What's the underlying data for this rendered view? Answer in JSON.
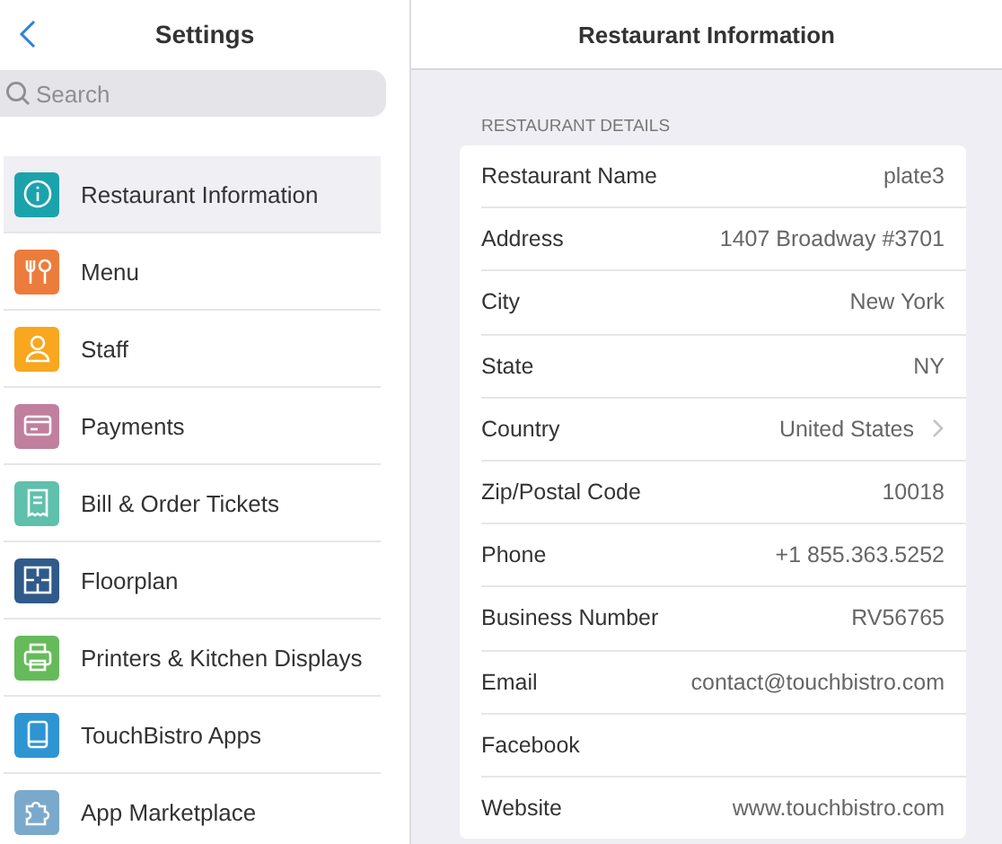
{
  "sidebar": {
    "title": "Settings",
    "search": {
      "placeholder": "Search"
    },
    "items": [
      {
        "label": "Restaurant Information",
        "kind": "info",
        "color": "#1ba3ac",
        "selected": true
      },
      {
        "label": "Menu",
        "kind": "utensils",
        "color": "#ec7c3c",
        "selected": false
      },
      {
        "label": "Staff",
        "kind": "person",
        "color": "#f8a71e",
        "selected": false
      },
      {
        "label": "Payments",
        "kind": "card",
        "color": "#c17f9e",
        "selected": false
      },
      {
        "label": "Bill & Order Tickets",
        "kind": "receipt",
        "color": "#5fc0ab",
        "selected": false
      },
      {
        "label": "Floorplan",
        "kind": "floorplan",
        "color": "#2f5a8a",
        "selected": false
      },
      {
        "label": "Printers & Kitchen Displays",
        "kind": "printer",
        "color": "#65bb5a",
        "selected": false
      },
      {
        "label": "TouchBistro Apps",
        "kind": "tablet",
        "color": "#2e95d3",
        "selected": false
      },
      {
        "label": "App Marketplace",
        "kind": "puzzle",
        "color": "#7aa9cc",
        "selected": false
      }
    ]
  },
  "detail": {
    "title": "Restaurant Information",
    "section": "RESTAURANT DETAILS",
    "rows": [
      {
        "label": "Restaurant Name",
        "value": "plate3",
        "kind": "text"
      },
      {
        "label": "Address",
        "value": "1407 Broadway #3701",
        "kind": "text"
      },
      {
        "label": "City",
        "value": "New York",
        "kind": "text"
      },
      {
        "label": "State",
        "value": "NY",
        "kind": "text"
      },
      {
        "label": "Country",
        "value": "United States",
        "kind": "link"
      },
      {
        "label": "Zip/Postal Code",
        "value": "10018",
        "kind": "text"
      },
      {
        "label": "Phone",
        "value": "+1 855.363.5252",
        "kind": "text"
      },
      {
        "label": "Business Number",
        "value": "RV56765",
        "kind": "text"
      },
      {
        "label": "Email",
        "value": "contact@touchbistro.com",
        "kind": "text"
      },
      {
        "label": "Facebook",
        "kind": "text"
      },
      {
        "label": "Website",
        "value": "www.touchbistro.com",
        "kind": "text"
      }
    ]
  }
}
